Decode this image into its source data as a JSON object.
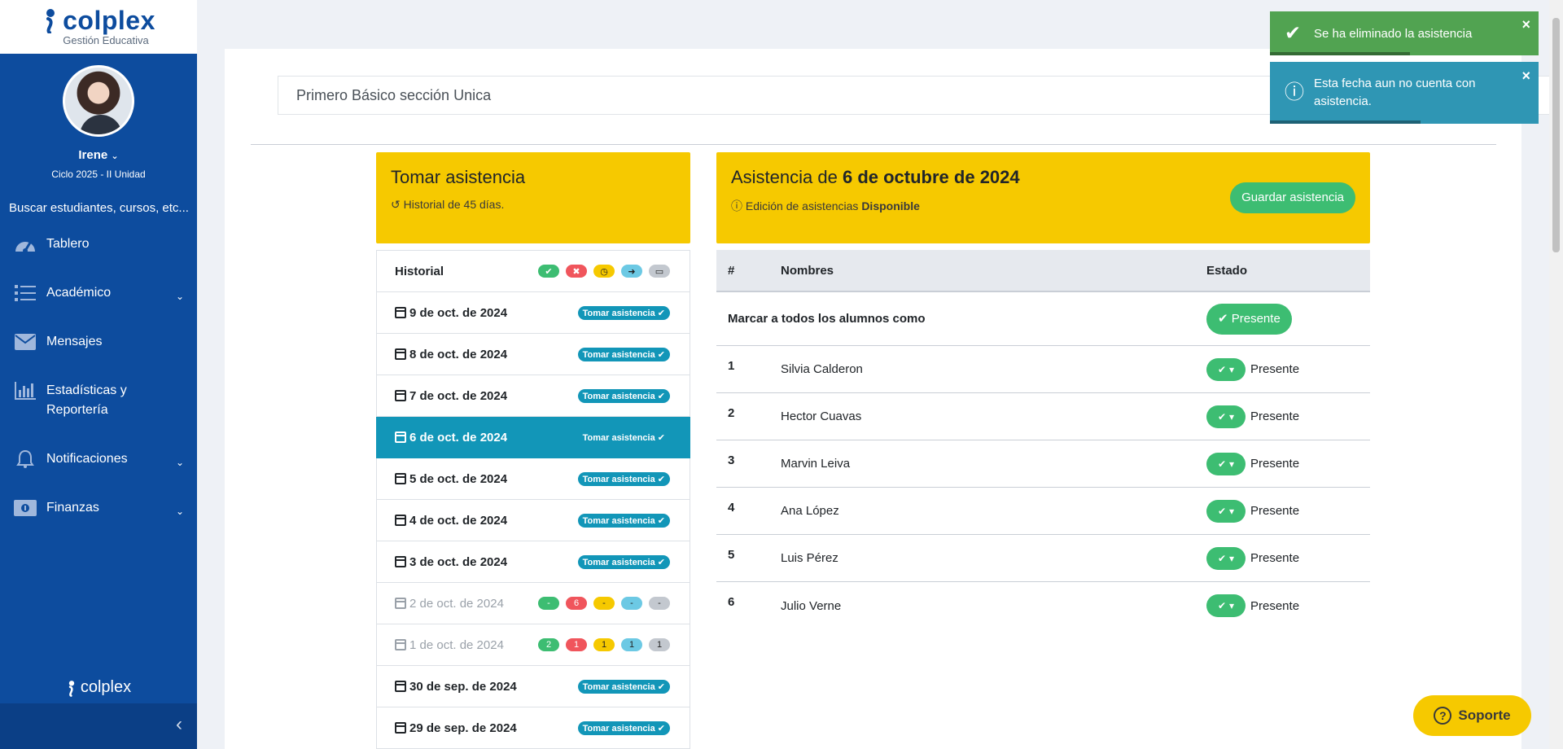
{
  "sidebar": {
    "brand": "colplex",
    "brand_sub": "Gestión Educativa",
    "user_name": "Irene",
    "user_cycle": "Ciclo 2025 - II Unidad",
    "search_placeholder": "Buscar estudiantes, cursos, etc...",
    "items": [
      {
        "label": "Tablero",
        "icon": "dashboard-icon"
      },
      {
        "label": "Académico",
        "icon": "list-icon"
      },
      {
        "label": "Mensajes",
        "icon": "envelope-icon"
      },
      {
        "label": "Estadísticas y",
        "label2": "Reportería",
        "icon": "bar-chart-icon"
      },
      {
        "label": "Notificaciones",
        "icon": "bell-icon"
      },
      {
        "label": "Finanzas",
        "icon": "money-icon"
      }
    ],
    "footer_brand": "colplex"
  },
  "course": "Primero Básico sección Unica",
  "left_card": {
    "title": "Tomar asistencia",
    "subtitle": "Historial de 45 días."
  },
  "right_card": {
    "title_prefix": "Asistencia de",
    "title_date": "6 de octubre de 2024",
    "subtitle_prefix": "Edición de asistencias",
    "subtitle_status": "Disponible",
    "save_label": "Guardar asistencia"
  },
  "history": {
    "label": "Historial",
    "take_label": "Tomar asistencia",
    "dates": [
      {
        "label": "9 de oct. de 2024",
        "type": "take"
      },
      {
        "label": "8 de oct. de 2024",
        "type": "take"
      },
      {
        "label": "7 de oct. de 2024",
        "type": "take"
      },
      {
        "label": "6 de oct. de 2024",
        "type": "take",
        "active": true
      },
      {
        "label": "5 de oct. de 2024",
        "type": "take"
      },
      {
        "label": "4 de oct. de 2024",
        "type": "take"
      },
      {
        "label": "3 de oct. de 2024",
        "type": "take"
      },
      {
        "label": "2 de oct. de 2024",
        "type": "counts",
        "counts": [
          "-",
          "6",
          "-",
          "-",
          "-"
        ]
      },
      {
        "label": "1 de oct. de 2024",
        "type": "counts",
        "counts": [
          "2",
          "1",
          "1",
          "1",
          "1"
        ]
      },
      {
        "label": "30 de sep. de 2024",
        "type": "take"
      },
      {
        "label": "29 de sep. de 2024",
        "type": "take"
      }
    ]
  },
  "table": {
    "headers": [
      "#",
      "Nombres",
      "Estado"
    ],
    "mark_all_label": "Marcar a todos los alumnos como",
    "mark_all_button": "Presente",
    "students": [
      {
        "num": "1",
        "name": "Silvia Calderon",
        "status": "Presente"
      },
      {
        "num": "2",
        "name": "Hector Cuavas",
        "status": "Presente"
      },
      {
        "num": "3",
        "name": "Marvin Leiva",
        "status": "Presente"
      },
      {
        "num": "4",
        "name": "Ana López",
        "status": "Presente"
      },
      {
        "num": "5",
        "name": "Luis Pérez",
        "status": "Presente"
      },
      {
        "num": "6",
        "name": "Julio Verne",
        "status": "Presente"
      }
    ]
  },
  "toasts": [
    {
      "text": "Se ha eliminado la asistencia",
      "type": "success"
    },
    {
      "text": "Esta fecha aun no cuenta con asistencia.",
      "type": "info"
    }
  ],
  "support_label": "Soporte"
}
